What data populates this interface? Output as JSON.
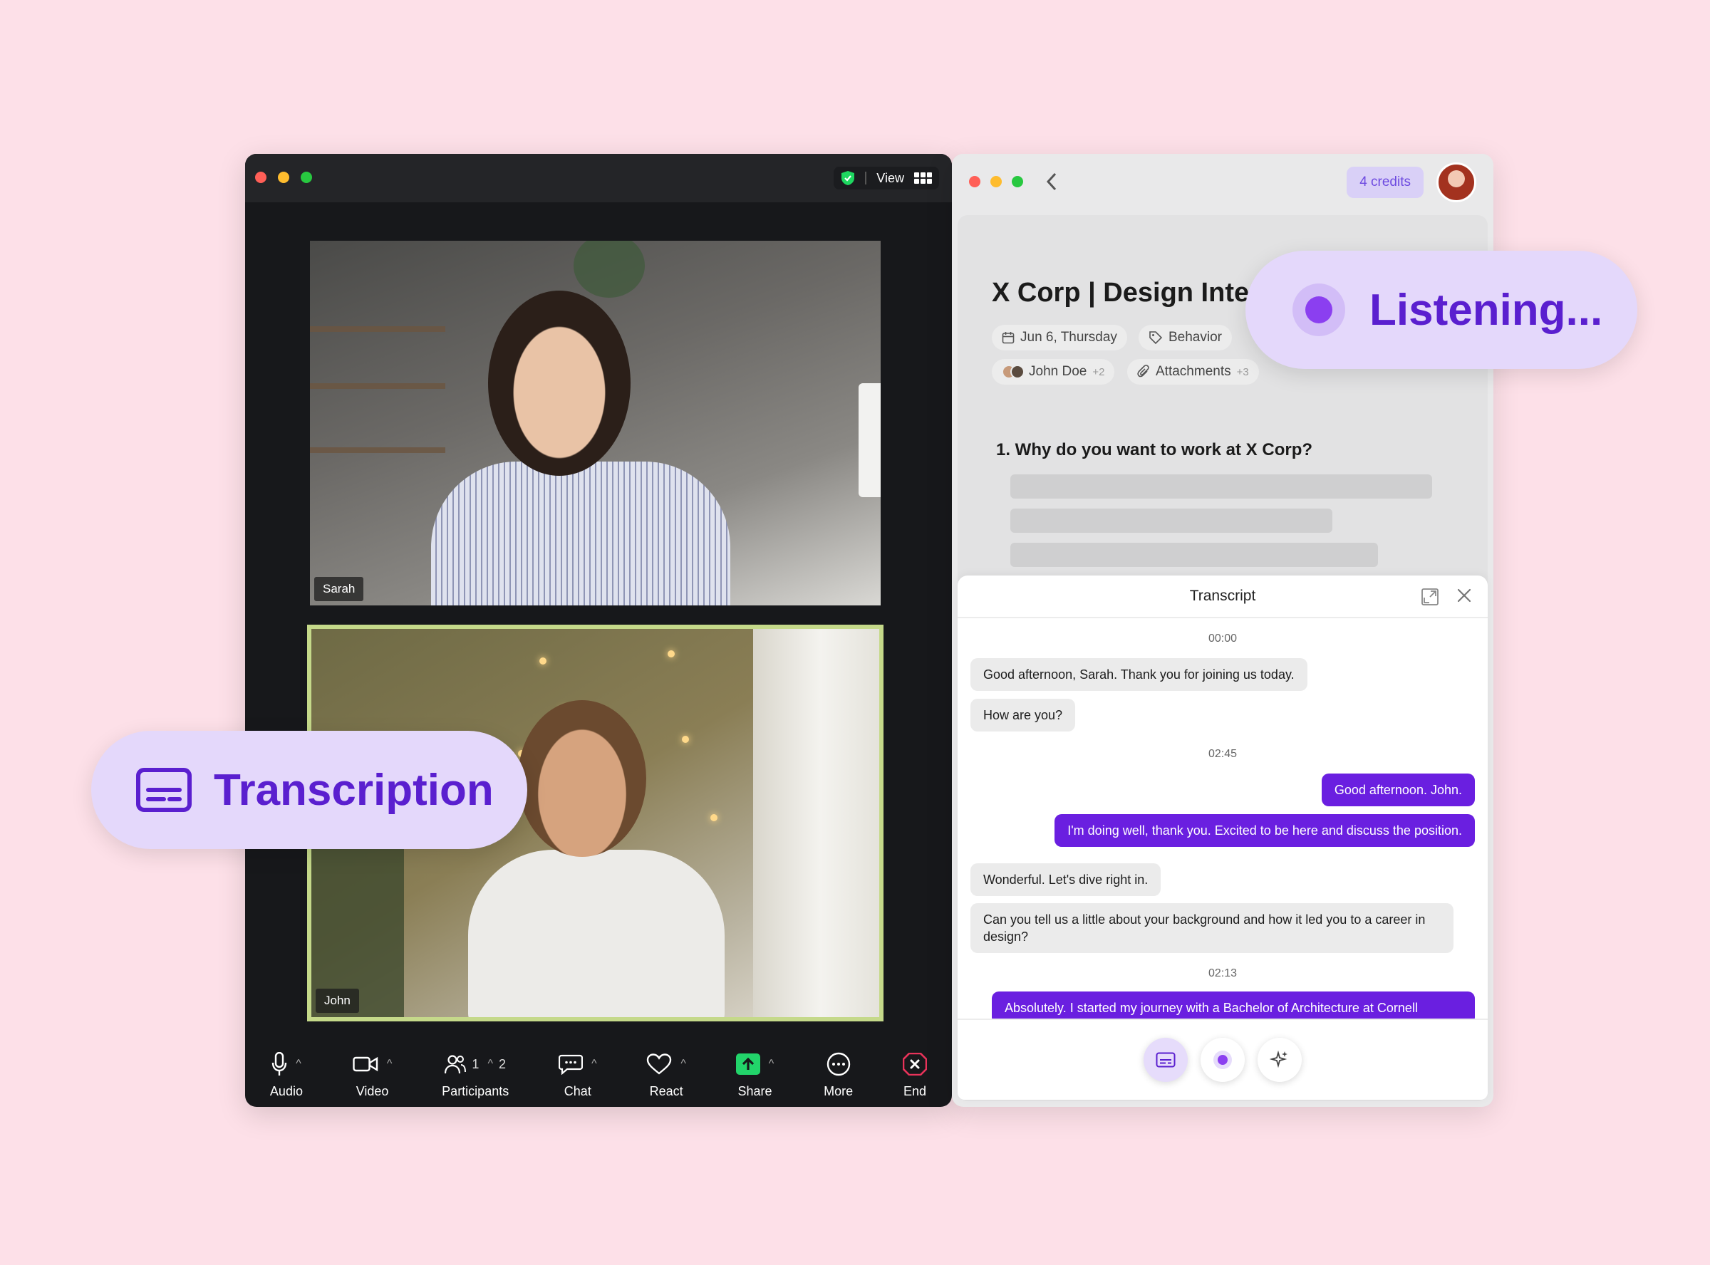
{
  "zoom": {
    "view_label": "View",
    "participants": [
      {
        "name": "Sarah"
      },
      {
        "name": "John"
      }
    ],
    "toolbar": {
      "audio": "Audio",
      "video": "Video",
      "participants": "Participants",
      "participants_count_a": "1",
      "participants_count_b": "2",
      "chat": "Chat",
      "react": "React",
      "share": "Share",
      "more": "More",
      "end": "End"
    }
  },
  "app": {
    "credits": "4 credits",
    "doc_title": "X Corp | Design Interv",
    "chips": {
      "date": "Jun 6, Thursday",
      "tag": "Behavior",
      "people": "John Doe",
      "people_more": "+2",
      "attachments": "Attachments",
      "attachments_more": "+3"
    },
    "question": "1.  Why do you want to work at X Corp?"
  },
  "transcript": {
    "title": "Transcript",
    "timestamps": [
      "00:00",
      "02:45",
      "02:13"
    ],
    "messages": [
      {
        "side": "in",
        "text": "Good afternoon, Sarah. Thank you for joining us today."
      },
      {
        "side": "in",
        "text": "How are you?"
      },
      {
        "side": "out",
        "text": "Good afternoon. John."
      },
      {
        "side": "out",
        "text": "I'm doing well, thank you. Excited to be here and discuss the position."
      },
      {
        "side": "in",
        "text": "Wonderful. Let's dive right in."
      },
      {
        "side": "in",
        "text": "Can you tell us a little about your background and how it led you to a career in design?"
      },
      {
        "side": "out",
        "text": "Absolutely. I started my journey with a Bachelor of Architecture at Cornell"
      }
    ]
  },
  "pills": {
    "transcription": "Transcription",
    "listening": "Listening..."
  },
  "colors": {
    "background": "#fde0e8",
    "accent_purple": "#6a1fe0",
    "pill_bg": "#e4d8fb",
    "active_border": "#c5d98a"
  }
}
